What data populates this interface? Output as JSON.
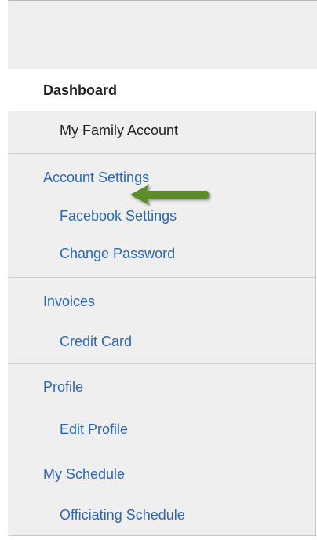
{
  "sidebar": {
    "dashboard": "Dashboard",
    "groups": [
      {
        "items": [
          "My Family Account"
        ]
      },
      {
        "heading": "Account Settings",
        "items": [
          "Facebook Settings",
          "Change Password"
        ]
      },
      {
        "heading": "Invoices",
        "items": [
          "Credit Card"
        ]
      },
      {
        "heading": "Profile",
        "items": [
          "Edit Profile"
        ]
      },
      {
        "heading": "My Schedule",
        "items": [
          "Officiating Schedule"
        ]
      }
    ]
  },
  "annotation": {
    "icon": "arrow-left-icon",
    "color": "#5b8c2a"
  },
  "colors": {
    "link": "#2d67b1",
    "panel": "#efefef",
    "text": "#222222"
  }
}
